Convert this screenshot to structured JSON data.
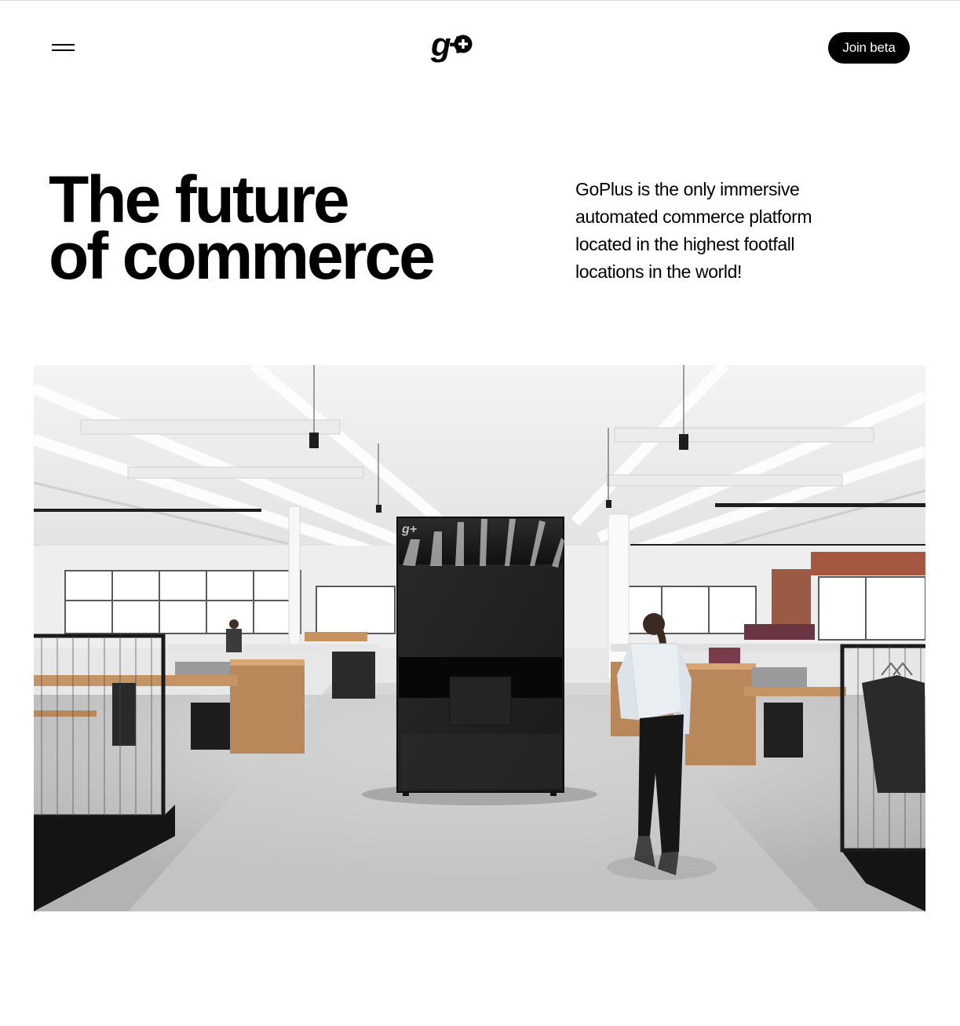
{
  "header": {
    "menu_icon": "hamburger-icon",
    "logo_text": "g+",
    "join_label": "Join beta"
  },
  "hero": {
    "title_line1": "The future",
    "title_line2": "of commerce",
    "description": "GoPlus is the only immersive automated commerce platform located in the highest footfall locations in the world!"
  },
  "image": {
    "alt": "Black GoPlus kiosk in an open office with a person walking by",
    "kiosk_logo": "g+",
    "kiosk_color": "#1c1c1e"
  },
  "colors": {
    "accent": "#000000",
    "background": "#ffffff"
  }
}
